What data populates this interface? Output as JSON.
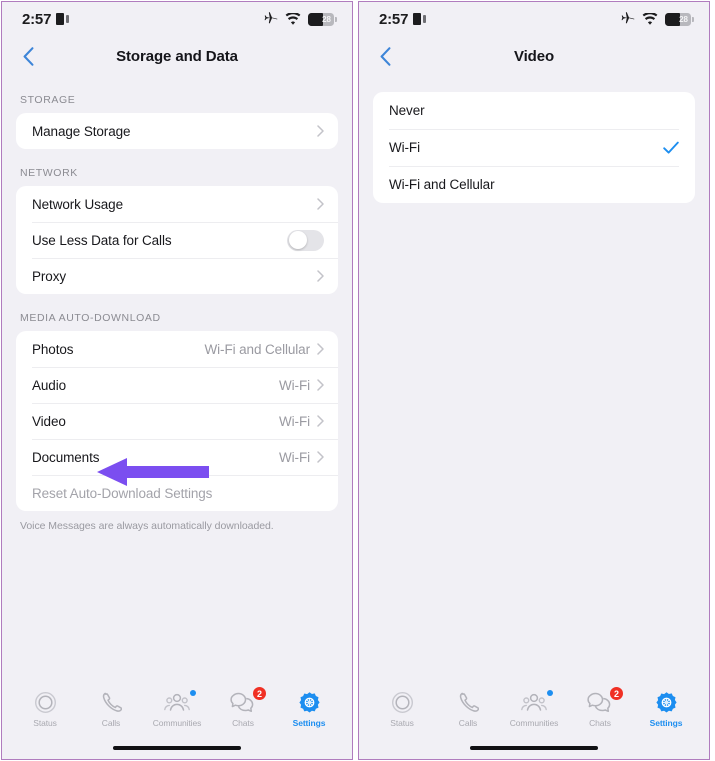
{
  "colors": {
    "accent_blue": "#1d8ef0",
    "annotation_purple": "#7b4ef0",
    "badge_red": "#f03024",
    "page_background": "#f1f0f5",
    "card_white": "#ffffff",
    "frame_border": "#b07cbe",
    "secondary_text": "#9a9aa1"
  },
  "left_panel": {
    "status_bar": {
      "time": "2:57",
      "sim_icon": "sim-card-icon",
      "airplane_icon": "airplane-mode-icon",
      "wifi_icon": "wifi-icon",
      "battery_icon": "battery-icon",
      "battery_level": "28"
    },
    "nav": {
      "back_icon": "chevron-left-icon",
      "title": "Storage and Data"
    },
    "sections": [
      {
        "header": "STORAGE",
        "rows": [
          {
            "label": "Manage Storage",
            "value": "",
            "accessory": "chevron-right-icon"
          }
        ]
      },
      {
        "header": "NETWORK",
        "rows": [
          {
            "label": "Network Usage",
            "value": "",
            "accessory": "chevron-right-icon"
          },
          {
            "label": "Use Less Data for Calls",
            "value": "",
            "accessory": "toggle-off"
          },
          {
            "label": "Proxy",
            "value": "",
            "accessory": "chevron-right-icon"
          }
        ]
      },
      {
        "header": "MEDIA AUTO-DOWNLOAD",
        "rows": [
          {
            "label": "Photos",
            "value": "Wi-Fi and Cellular",
            "accessory": "chevron-right-icon"
          },
          {
            "label": "Audio",
            "value": "Wi-Fi",
            "accessory": "chevron-right-icon"
          },
          {
            "label": "Video",
            "value": "Wi-Fi",
            "accessory": "chevron-right-icon"
          },
          {
            "label": "Documents",
            "value": "Wi-Fi",
            "accessory": "chevron-right-icon"
          },
          {
            "label": "Reset Auto-Download Settings",
            "value": "",
            "accessory": "none"
          }
        ],
        "footnote": "Voice Messages are always automatically downloaded."
      }
    ],
    "annotation": {
      "shape": "left-pointing-arrow",
      "points_at": "Video"
    }
  },
  "right_panel": {
    "status_bar": {
      "time": "2:57",
      "sim_icon": "sim-card-icon",
      "airplane_icon": "airplane-mode-icon",
      "wifi_icon": "wifi-icon",
      "battery_icon": "battery-icon",
      "battery_level": "28"
    },
    "nav": {
      "back_icon": "chevron-left-icon",
      "title": "Video"
    },
    "options": [
      {
        "label": "Never",
        "selected": false
      },
      {
        "label": "Wi-Fi",
        "selected": true
      },
      {
        "label": "Wi-Fi and Cellular",
        "selected": false
      }
    ]
  },
  "tab_bar": {
    "items": [
      {
        "label": "Status",
        "icon": "status-rings-icon",
        "active": false,
        "badge": "",
        "dot": false
      },
      {
        "label": "Calls",
        "icon": "phone-handset-icon",
        "active": false,
        "badge": "",
        "dot": false
      },
      {
        "label": "Communities",
        "icon": "communities-people-icon",
        "active": false,
        "badge": "",
        "dot": true
      },
      {
        "label": "Chats",
        "icon": "chat-bubbles-icon",
        "active": false,
        "badge": "2",
        "dot": false
      },
      {
        "label": "Settings",
        "icon": "gear-icon",
        "active": true,
        "badge": "",
        "dot": false
      }
    ]
  }
}
